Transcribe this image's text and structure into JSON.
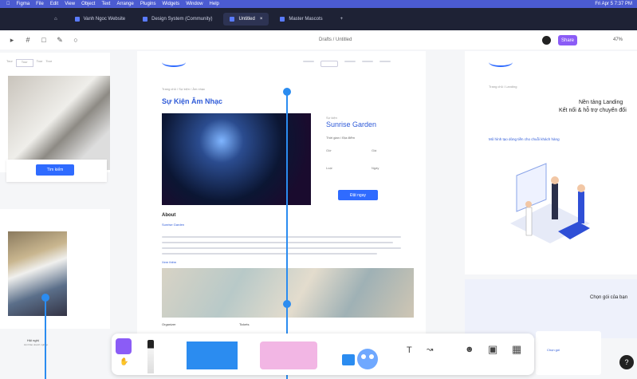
{
  "menubar": {
    "apple": "",
    "items": [
      "Figma",
      "File",
      "Edit",
      "View",
      "Object",
      "Text",
      "Arrange",
      "Plugins",
      "Widgets",
      "Window",
      "Help"
    ],
    "clock": "Fri Apr 5 7:37 PM"
  },
  "tabs": [
    {
      "label": "Vanh Ngoc Website"
    },
    {
      "label": "Design System (Community)"
    },
    {
      "label": "Untitled"
    },
    {
      "label": "Master Mascots"
    }
  ],
  "toolbar": {
    "breadcrumb": "Drafts / Untitled",
    "share_label": "Share",
    "zoom": "47%"
  },
  "page_left": {
    "nav_tabs": [
      "Tour",
      "Tour",
      "Tour",
      "Tour"
    ],
    "button": "Tìm kiếm",
    "caption1": "Hội nghị",
    "caption2": "Hội thảo doanh nghiệp"
  },
  "page_center": {
    "breadcrumb": "Trang chủ / Sự kiện / Âm nhạc",
    "title": "Sự Kiện Âm Nhạc",
    "event_label": "Sự kiện",
    "event_name": "Sunrise Garden",
    "event_meta": "Thời gian / Địa điểm",
    "rows": [
      "Giờ",
      "Giá",
      "Loại",
      "Ngày"
    ],
    "cta": "Đặt ngay",
    "about": "About",
    "about_sub": "Sunrise Garden",
    "read_more": "Xem thêm",
    "footer_labels": [
      "Organizer",
      "Tickets"
    ]
  },
  "page_right": {
    "breadcrumb": "Trang chủ / Landing",
    "headline1": "Nền tảng Landing",
    "headline2": "Kết nối & hỗ trợ chuyển đổi",
    "subhead": "Mô hình tạo dòng tiền cho chuỗi khách hàng",
    "section": "Chọn gói của bạn",
    "pricing_btn": "Chọn gói"
  },
  "bottom": {
    "text_tool": "T",
    "help": "?"
  },
  "colors": {
    "accent": "#8b5cf6",
    "selection": "#2b8cf0",
    "brand_blue": "#2f6bff"
  }
}
